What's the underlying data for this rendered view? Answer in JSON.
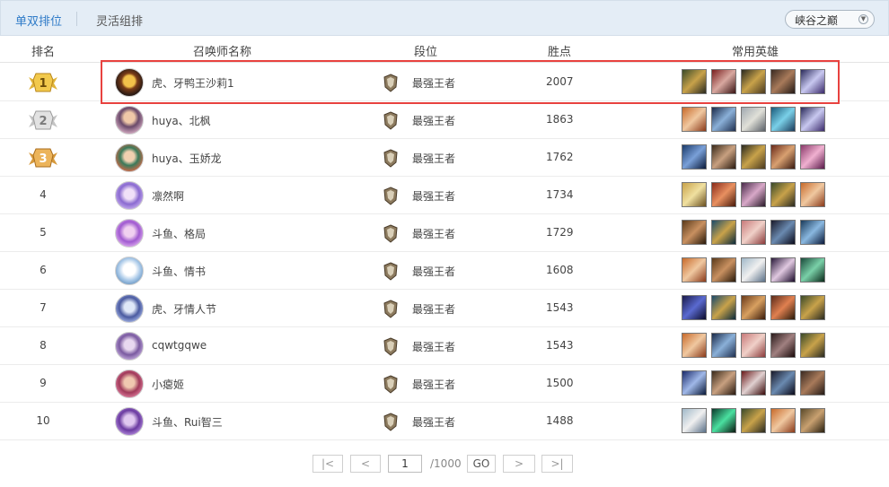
{
  "tabs": {
    "active": "单双排位",
    "inactive": "灵活组排"
  },
  "server": "峡谷之巅",
  "headers": {
    "rank": "排名",
    "name": "召唤师名称",
    "tier": "段位",
    "points": "胜点",
    "heroes": "常用英雄"
  },
  "rows": [
    {
      "rank": "1",
      "name": "虎、牙鸭王沙莉1",
      "tier": "最强王者",
      "points": "2007"
    },
    {
      "rank": "2",
      "name": "huya、北枫",
      "tier": "最强王者",
      "points": "1863"
    },
    {
      "rank": "3",
      "name": "huya、玉娇龙",
      "tier": "最强王者",
      "points": "1762"
    },
    {
      "rank": "4",
      "name": "凛然啊",
      "tier": "最强王者",
      "points": "1734"
    },
    {
      "rank": "5",
      "name": "斗鱼、格局",
      "tier": "最强王者",
      "points": "1729"
    },
    {
      "rank": "6",
      "name": "斗鱼、情书",
      "tier": "最强王者",
      "points": "1608"
    },
    {
      "rank": "7",
      "name": "虎、牙情人节",
      "tier": "最强王者",
      "points": "1543"
    },
    {
      "rank": "8",
      "name": "cqwtgqwe",
      "tier": "最强王者",
      "points": "1543"
    },
    {
      "rank": "9",
      "name": "小瘪姬",
      "tier": "最强王者",
      "points": "1500"
    },
    {
      "rank": "10",
      "name": "斗鱼、Rui智三",
      "tier": "最强王者",
      "points": "1488"
    }
  ],
  "pagination": {
    "current_page": "1",
    "total": "/1000",
    "go_label": "GO"
  },
  "colors": {
    "accent": "#2f7bc8",
    "highlight": "#e8423f",
    "gold": "#e0b43a",
    "silver": "#bfbfbf",
    "bronze": "#d79a3c"
  }
}
